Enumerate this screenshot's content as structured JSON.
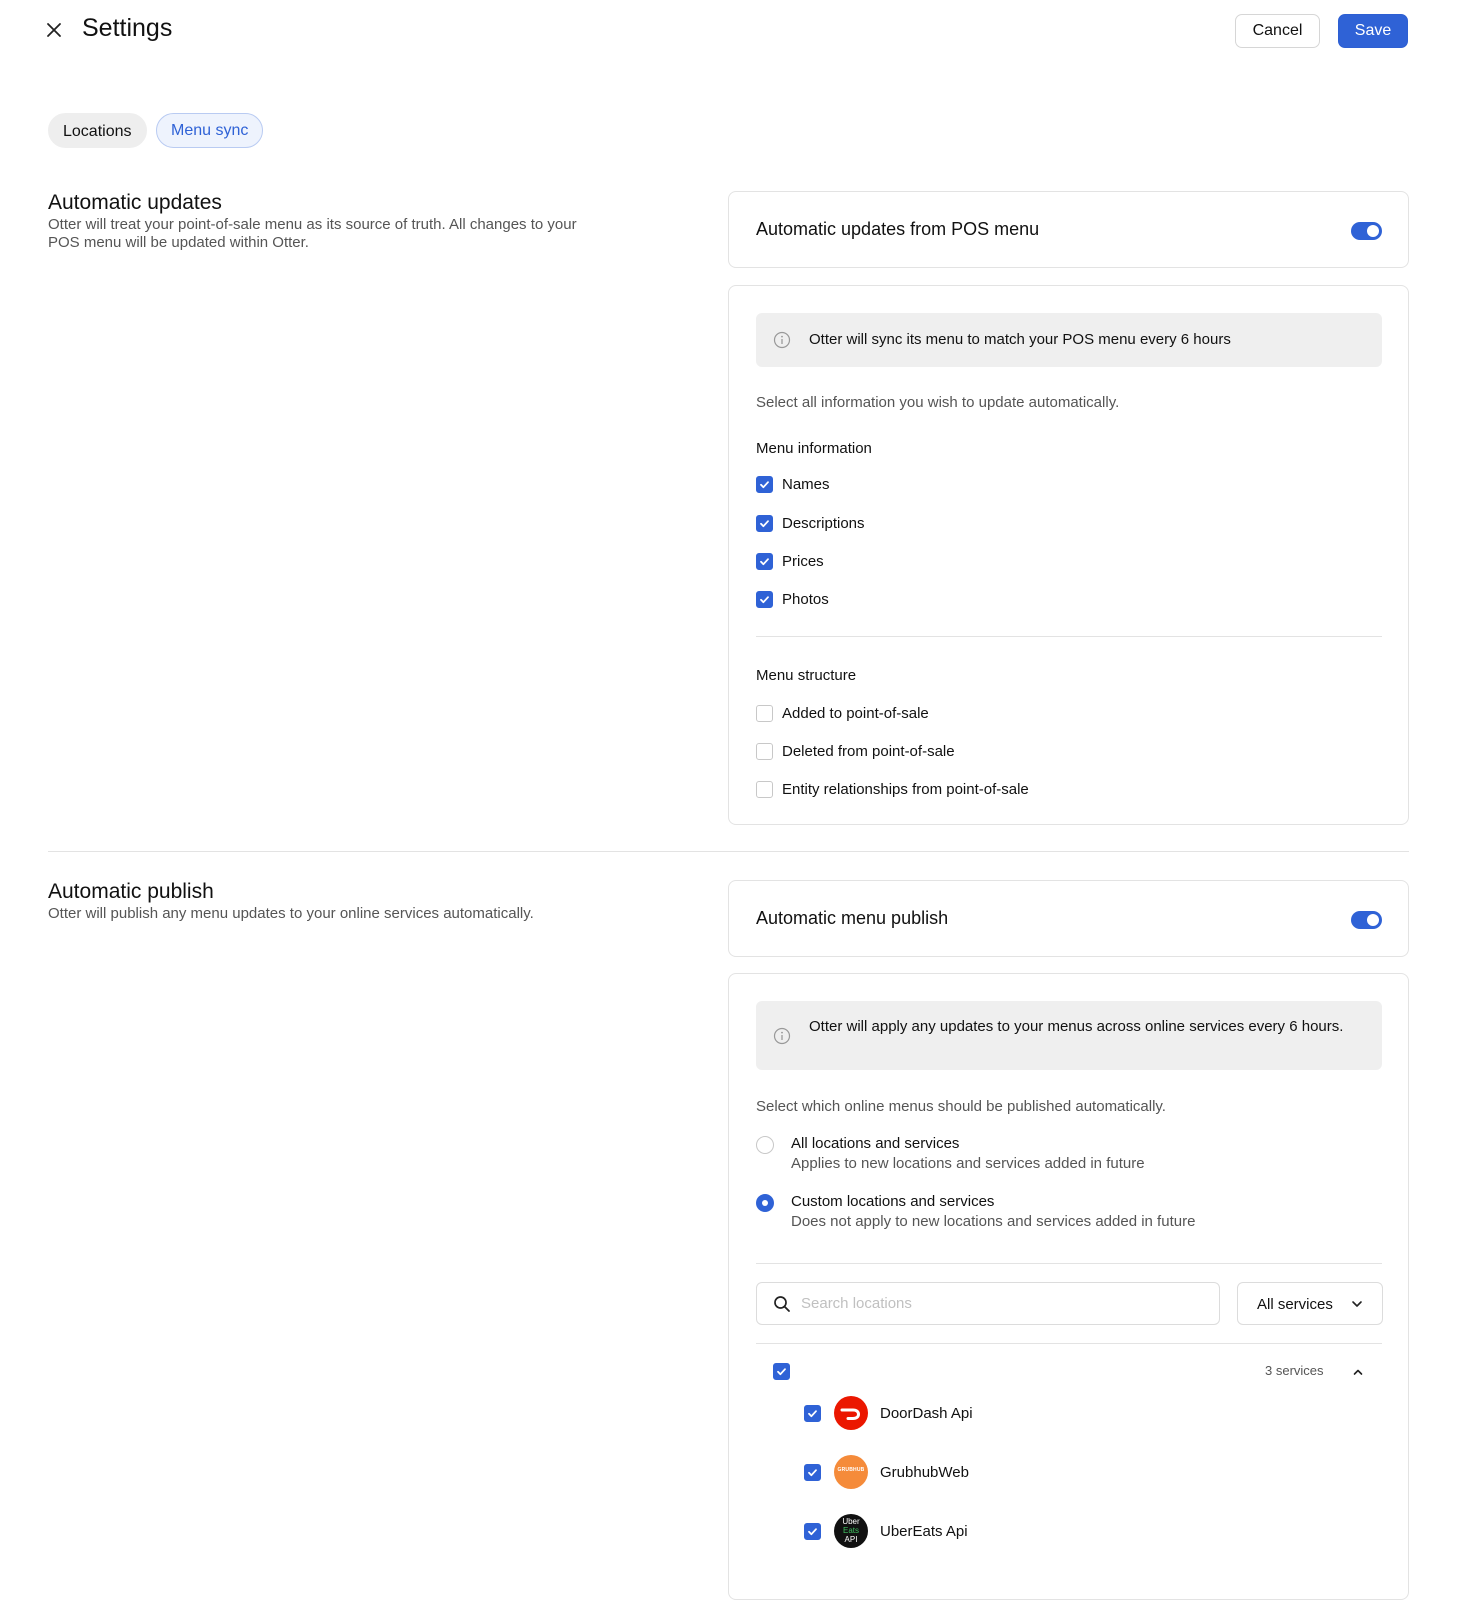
{
  "header": {
    "title": "Settings",
    "cancel_label": "Cancel",
    "save_label": "Save"
  },
  "tabs": [
    {
      "label": "Locations",
      "active": false
    },
    {
      "label": "Menu sync",
      "active": true
    }
  ],
  "automatic_updates": {
    "title": "Automatic updates",
    "description": "Otter will treat your point-of-sale menu as its source of truth. All changes to your POS menu will be updated within Otter.",
    "toggle_label": "Automatic updates from POS menu",
    "toggle_on": true,
    "info": "Otter will sync its menu to match your POS menu every 6 hours",
    "instruction": "Select all information you wish to update automatically.",
    "menu_information": {
      "label": "Menu information",
      "items": [
        {
          "label": "Names",
          "checked": true
        },
        {
          "label": "Descriptions",
          "checked": true
        },
        {
          "label": "Prices",
          "checked": true
        },
        {
          "label": "Photos",
          "checked": true
        }
      ]
    },
    "menu_structure": {
      "label": "Menu structure",
      "items": [
        {
          "label": "Added to point-of-sale",
          "checked": false
        },
        {
          "label": "Deleted from point-of-sale",
          "checked": false
        },
        {
          "label": "Entity relationships from point-of-sale",
          "checked": false
        }
      ]
    }
  },
  "automatic_publish": {
    "title": "Automatic publish",
    "description": "Otter will publish any menu updates to your online services automatically.",
    "toggle_label": "Automatic menu publish",
    "toggle_on": true,
    "info": "Otter will apply any updates to your menus across online services every 6 hours.",
    "instruction": "Select which online menus should be published automatically.",
    "options": [
      {
        "label": "All locations and services",
        "sub": "Applies to new locations and services added in future",
        "selected": false
      },
      {
        "label": "Custom locations and services",
        "sub": "Does not apply to new locations and services added in future",
        "selected": true
      }
    ],
    "search": {
      "placeholder": "Search locations",
      "value": ""
    },
    "services_filter": "All services",
    "location_group": {
      "checked": true,
      "service_count": "3 services",
      "expanded": true
    },
    "services": [
      {
        "name": "DoorDash Api",
        "checked": true,
        "logo": "doordash-logo",
        "color": "#eb1700"
      },
      {
        "name": "GrubhubWeb",
        "checked": true,
        "logo": "grubhub-logo",
        "color": "#f58b3a",
        "logo_text": "GRUBHUB"
      },
      {
        "name": "UberEats Api",
        "checked": true,
        "logo": "ubereats-logo",
        "color": "#111111",
        "logo_text": [
          "Uber",
          "Eats",
          "API"
        ]
      }
    ]
  },
  "colors": {
    "accent": "#2f62d6",
    "border": "#e3e3e3",
    "info_bg": "#efefef"
  }
}
